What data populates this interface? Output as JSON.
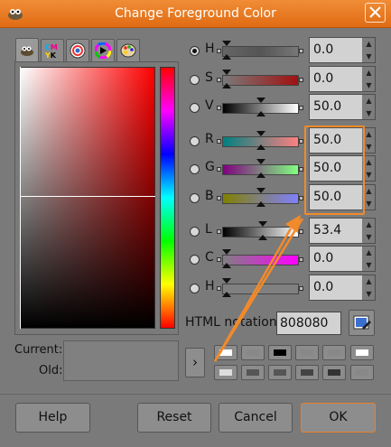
{
  "window": {
    "title": "Change Foreground Color"
  },
  "tabs": [
    {
      "name": "gimp-selector",
      "icon": "wilber-icon"
    },
    {
      "name": "cmyk",
      "icon": "cmyk-icon",
      "text": "CMYK"
    },
    {
      "name": "watercolor",
      "icon": "watercolor-icon"
    },
    {
      "name": "wheel",
      "icon": "color-wheel-icon"
    },
    {
      "name": "palette",
      "icon": "palette-icon"
    }
  ],
  "channels": [
    {
      "label": "H",
      "value": "0.0",
      "selected": true,
      "marker": 0.0
    },
    {
      "label": "S",
      "value": "0.0",
      "selected": false,
      "marker": 0.0
    },
    {
      "label": "V",
      "value": "50.0",
      "selected": false,
      "marker": 0.5
    },
    {
      "label": "R",
      "value": "50.0",
      "selected": false,
      "marker": 0.5
    },
    {
      "label": "G",
      "value": "50.0",
      "selected": false,
      "marker": 0.5
    },
    {
      "label": "B",
      "value": "50.0",
      "selected": false,
      "marker": 0.5
    },
    {
      "label": "L",
      "value": "53.4",
      "selected": false,
      "marker": 0.534
    },
    {
      "label": "C",
      "value": "0.0",
      "selected": false,
      "marker": 0.0
    },
    {
      "label": "H",
      "value": "0.0",
      "selected": false,
      "marker": 0.0
    }
  ],
  "html_notation": {
    "label": "HTML notation:",
    "value": "808080"
  },
  "swatch": {
    "current_label": "Current:",
    "old_label": "Old:",
    "current_color": "#808080",
    "old_color": "#808080"
  },
  "history_colors": [
    "#ffffff",
    "#888888",
    "#000000",
    "#888888",
    "#888888",
    "#ffffff",
    "#dddddd",
    "#555555",
    "#555555",
    "#444444",
    "#333333",
    "#888888"
  ],
  "buttons": {
    "help": "Help",
    "reset": "Reset",
    "cancel": "Cancel",
    "ok": "OK",
    "apply_arrow": "›"
  },
  "colors": {
    "accent": "#f28a2a",
    "titlebar": "#e8781e"
  }
}
